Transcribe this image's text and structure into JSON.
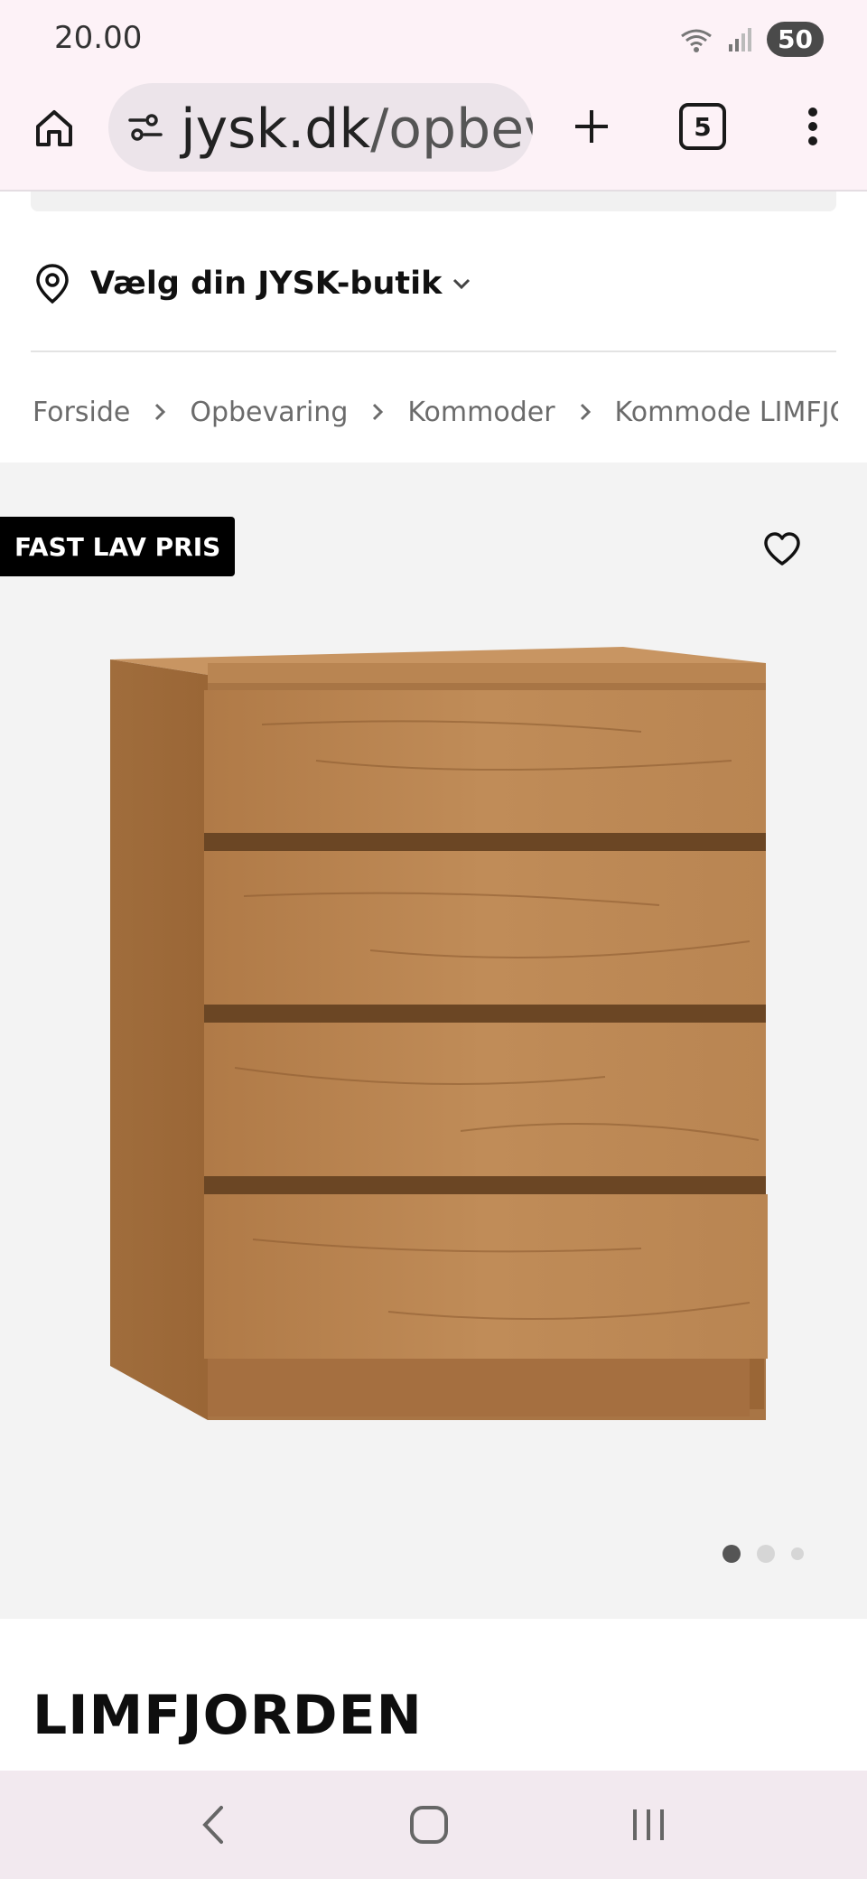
{
  "status_bar": {
    "time": "20.00",
    "battery": "50"
  },
  "browser": {
    "url": "jysk.dk/opbev",
    "url_domain": "jysk.dk",
    "url_path": "/opbev",
    "tab_count": "5"
  },
  "store": {
    "label": "Vælg din JYSK-butik"
  },
  "breadcrumb": [
    "Forside",
    "Opbevaring",
    "Kommoder",
    "Kommode LIMFJORDEN"
  ],
  "product": {
    "badge": "FAST LAV PRIS",
    "title": "LIMFJORDEN",
    "image_alt": "Kommode med 4 skuffer i egetræ-look",
    "gallery_count": 3,
    "gallery_active": 1
  },
  "colors": {
    "accent_bg": "#fdf2f7",
    "badge_bg": "#000000",
    "wood": "#b98552"
  }
}
